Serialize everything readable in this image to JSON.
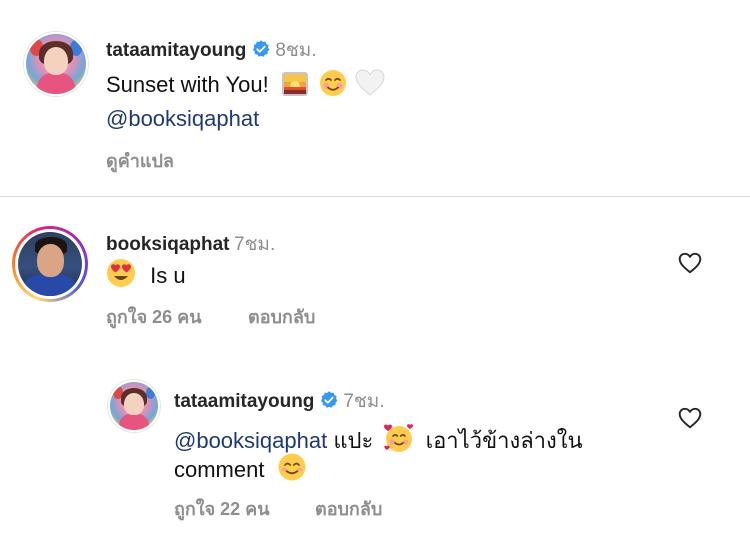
{
  "post": {
    "username": "tataamitayoung",
    "time": "8ชม.",
    "caption_text": "Sunset with You!",
    "caption_emojis": [
      "sunset-emoji",
      "smiling-face-emoji",
      "white-heart-emoji"
    ],
    "mention": "@booksiqaphat",
    "translate_label": "ดูคำแปล"
  },
  "comments": [
    {
      "username": "booksiqaphat",
      "time": "7ชม.",
      "emoji": "heart-eyes-emoji",
      "text": "Is u",
      "likes": "ถูกใจ 26 คน",
      "reply_label": "ตอบกลับ"
    },
    {
      "username": "tataamitayoung",
      "time": "7ชม.",
      "mention": "@booksiqaphat",
      "text_part1": "แปะ",
      "text_part2": "เอาไว้ข้างล่างใน",
      "text_line2": "comment",
      "likes": "ถูกใจ 22 คน",
      "reply_label": "ตอบกลับ"
    }
  ],
  "colors": {
    "verified_blue": "#3897f0",
    "mention": "#1f3a6e",
    "muted": "#8e8e8e"
  }
}
